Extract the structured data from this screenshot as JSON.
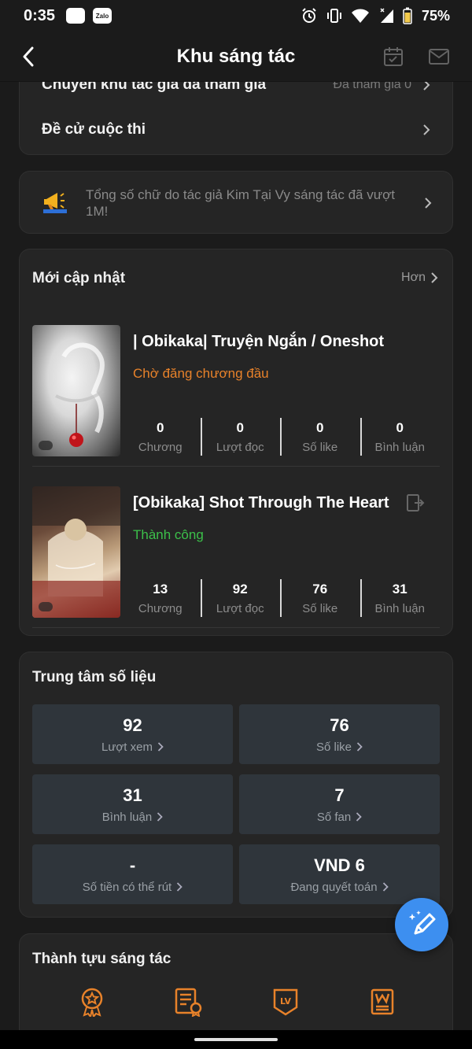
{
  "status_bar": {
    "time": "0:35",
    "app_icon_1": "",
    "app_icon_2": "Zalo",
    "battery": "75%"
  },
  "header": {
    "title": "Khu sáng tác"
  },
  "top_card": {
    "row1_label": "Chuyên khu tác giả đã tham gia",
    "row1_value": "Đã tham gia 0",
    "row2_label": "Đề cử cuộc thi"
  },
  "notice": {
    "text": "Tổng số chữ do tác giả Kim Tại Vy sáng tác đã vượt 1M!"
  },
  "recent": {
    "title": "Mới cập nhật",
    "more": "Hơn",
    "books": [
      {
        "title": "| Obikaka| Truyện Ngắn / Oneshot",
        "status": "Chờ đăng chương đầu",
        "status_color": "#e8822a",
        "stats": [
          {
            "value": "0",
            "label": "Chương"
          },
          {
            "value": "0",
            "label": "Lượt đọc"
          },
          {
            "value": "0",
            "label": "Số like"
          },
          {
            "value": "0",
            "label": "Bình luận"
          }
        ]
      },
      {
        "title": "[Obikaka] Shot Through The Heart",
        "status": "Thành công",
        "status_color": "#3cc04a",
        "stats": [
          {
            "value": "13",
            "label": "Chương"
          },
          {
            "value": "92",
            "label": "Lượt đọc"
          },
          {
            "value": "76",
            "label": "Số like"
          },
          {
            "value": "31",
            "label": "Bình luận"
          }
        ]
      }
    ]
  },
  "data_center": {
    "title": "Trung tâm số liệu",
    "metrics": [
      {
        "value": "92",
        "label": "Lượt xem"
      },
      {
        "value": "76",
        "label": "Số like"
      },
      {
        "value": "31",
        "label": "Bình luận"
      },
      {
        "value": "7",
        "label": "Số fan"
      },
      {
        "value": "-",
        "label": "Số tiền có thể rút"
      },
      {
        "value": "VND 6",
        "label": "Đang quyết toán"
      }
    ]
  },
  "achievements": {
    "title": "Thành tựu sáng tác",
    "icons": [
      "medal-icon",
      "certificate-icon",
      "level-badge-icon",
      "writer-badge-icon"
    ]
  },
  "colors": {
    "accent_orange": "#e8822a",
    "success_green": "#3cc04a",
    "fab_blue": "#3d8ff0",
    "card_bg": "#252525",
    "metric_bg": "#2f353b"
  }
}
